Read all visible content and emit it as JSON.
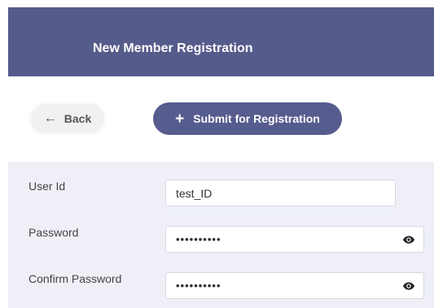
{
  "header": {
    "title": "New Member Registration"
  },
  "toolbar": {
    "back": {
      "icon": "←",
      "label": "Back"
    },
    "submit": {
      "icon": "+",
      "label": "Submit for Registration"
    }
  },
  "form": {
    "user_id": {
      "label": "User Id",
      "value": "test_ID"
    },
    "password": {
      "label": "Password",
      "value": "••••••••••",
      "icon": "eye-icon"
    },
    "confirm_password": {
      "label": "Confirm Password",
      "value": "••••••••••",
      "icon": "eye-icon"
    }
  },
  "colors": {
    "header": "#555b8a",
    "primary_button": "#565c8e",
    "form_bg": "#eff0f7"
  }
}
